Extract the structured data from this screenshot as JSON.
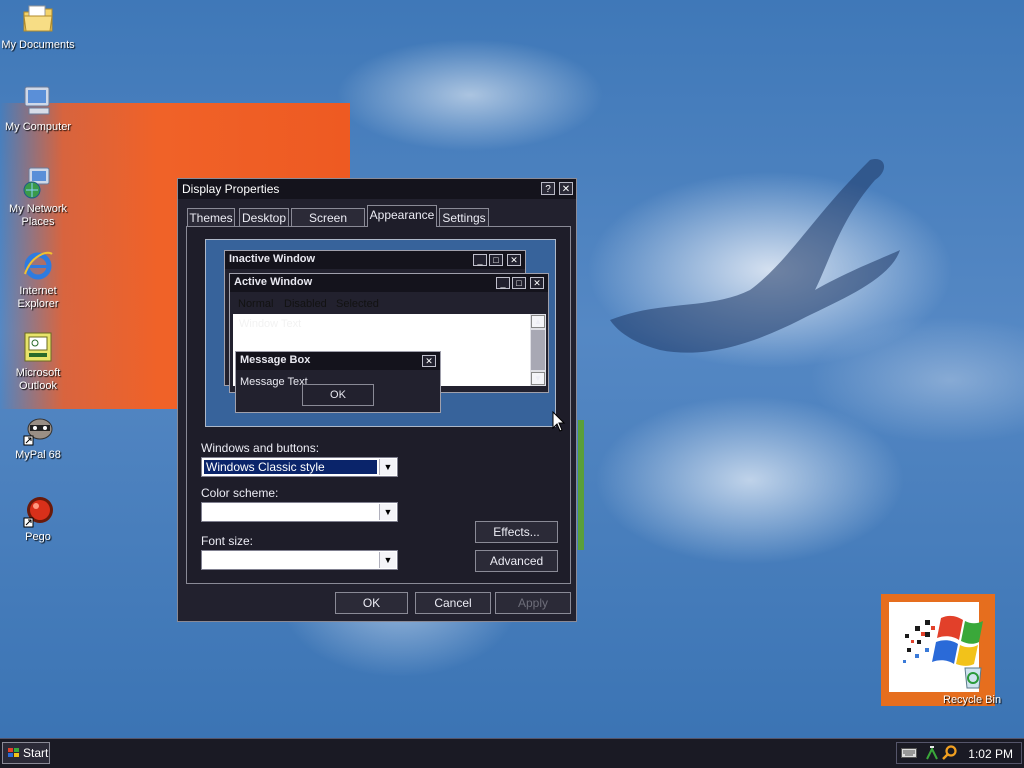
{
  "desktop": {
    "icons": [
      {
        "label": "My Documents",
        "icon": "folder-documents-icon"
      },
      {
        "label": "My Computer",
        "icon": "computer-icon"
      },
      {
        "label": "My Network Places",
        "icon": "network-globe-icon"
      },
      {
        "label": "Internet Explorer",
        "icon": "internet-explorer-icon"
      },
      {
        "label": "Microsoft Outlook",
        "icon": "outlook-icon"
      },
      {
        "label": "MyPal 68",
        "icon": "mypal-raccoon-icon"
      },
      {
        "label": "Pego",
        "icon": "pego-red-orb-icon"
      }
    ],
    "recycle_bin": {
      "label": "Recycle Bin",
      "icon": "recycle-bin-icon"
    }
  },
  "dialog": {
    "title": "Display Properties",
    "help_button": "?",
    "close_button": "✕",
    "tabs": [
      {
        "label": "Themes"
      },
      {
        "label": "Desktop"
      },
      {
        "label": "Screen Saver"
      },
      {
        "label": "Appearance",
        "active": true
      },
      {
        "label": "Settings"
      }
    ],
    "preview": {
      "inactive_title": "Inactive Window",
      "active_title": "Active Window",
      "menu": [
        "Normal",
        "Disabled",
        "Selected"
      ],
      "window_text": "Window Text",
      "msgbox_title": "Message Box",
      "msgbox_text": "Message Text",
      "msgbox_ok": "OK"
    },
    "windows_and_buttons": {
      "label": "Windows and buttons:",
      "value": "Windows Classic style"
    },
    "color_scheme": {
      "label": "Color scheme:",
      "value": ""
    },
    "font_size": {
      "label": "Font size:",
      "value": ""
    },
    "effects_button": "Effects...",
    "advanced_button": "Advanced",
    "ok_button": "OK",
    "cancel_button": "Cancel",
    "apply_button": "Apply"
  },
  "taskbar": {
    "start_label": "Start",
    "clock": "1:02 PM",
    "tray_icons": [
      "keyboard-icon",
      "network-tray-icon",
      "search-tray-icon"
    ]
  },
  "colors": {
    "desktop_blue": "#4a80be",
    "dialog_bg": "#22212e",
    "selection_blue": "#0a246a",
    "banner_orange": "#f06228"
  }
}
